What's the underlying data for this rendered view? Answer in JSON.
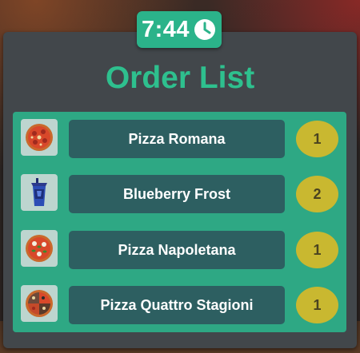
{
  "timer": {
    "time": "7:44",
    "icon": "clock-icon"
  },
  "title": "Order List",
  "orders": [
    {
      "name": "Pizza Romana",
      "quantity": "1",
      "icon": "pizza-romana-icon"
    },
    {
      "name": "Blueberry Frost",
      "quantity": "2",
      "icon": "blueberry-frost-drink-icon"
    },
    {
      "name": "Pizza Napoletana",
      "quantity": "1",
      "icon": "pizza-napoletana-icon"
    },
    {
      "name": "Pizza Quattro Stagioni",
      "quantity": "1",
      "icon": "pizza-quattro-stagioni-icon"
    }
  ],
  "colors": {
    "accent": "#2ec08e",
    "list_background": "#2ea884",
    "item_box": "#2d5f61",
    "quantity_badge": "#c9b830",
    "panel": "#42474b"
  }
}
